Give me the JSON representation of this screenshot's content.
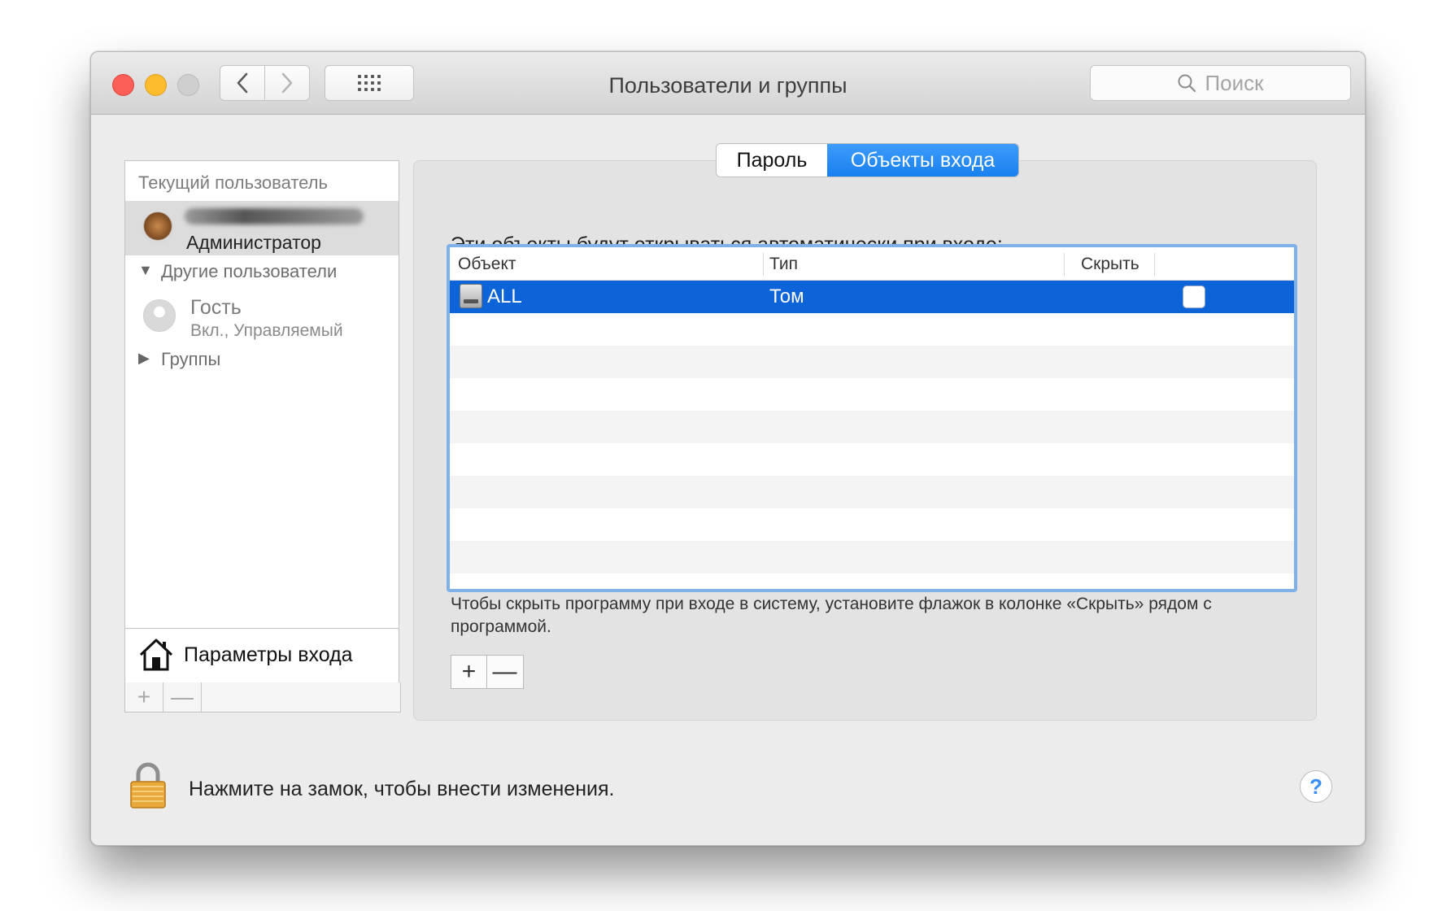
{
  "window": {
    "title": "Пользователи и группы"
  },
  "toolbar": {
    "back_icon": "chevron-left-icon",
    "forward_icon": "chevron-right-icon",
    "grid_icon": "grid-icon",
    "search_placeholder": "Поиск"
  },
  "sidebar": {
    "current_user_header": "Текущий пользователь",
    "current_user_role": "Администратор",
    "other_users_header": "Другие пользователи",
    "guest_name": "Гость",
    "guest_status": "Вкл., Управляемый",
    "groups_label": "Группы",
    "login_options_label": "Параметры входа",
    "add_symbol": "+",
    "remove_symbol": "—"
  },
  "tabs": [
    {
      "label": "Пароль",
      "active": false
    },
    {
      "label": "Объекты входа",
      "active": true
    }
  ],
  "login_items": {
    "heading": "Эти объекты будут открываться автоматически при входе:",
    "columns": [
      "Объект",
      "Тип",
      "Скрыть"
    ],
    "rows": [
      {
        "item": "ALL",
        "type": "Том",
        "hide": false,
        "selected": true
      }
    ],
    "hint": "Чтобы скрыть программу при входе в систему, установите флажок в колонке «Скрыть» рядом с программой.",
    "add_symbol": "+",
    "remove_symbol": "—"
  },
  "footer": {
    "lock_text": "Нажмите на замок, чтобы внести изменения.",
    "help_symbol": "?"
  },
  "colors": {
    "accent": "#1880f1",
    "selection": "#0d63d8",
    "close": "#fc5f57",
    "minimize": "#fdbc2e",
    "lock_gold": "#e9a93a"
  }
}
